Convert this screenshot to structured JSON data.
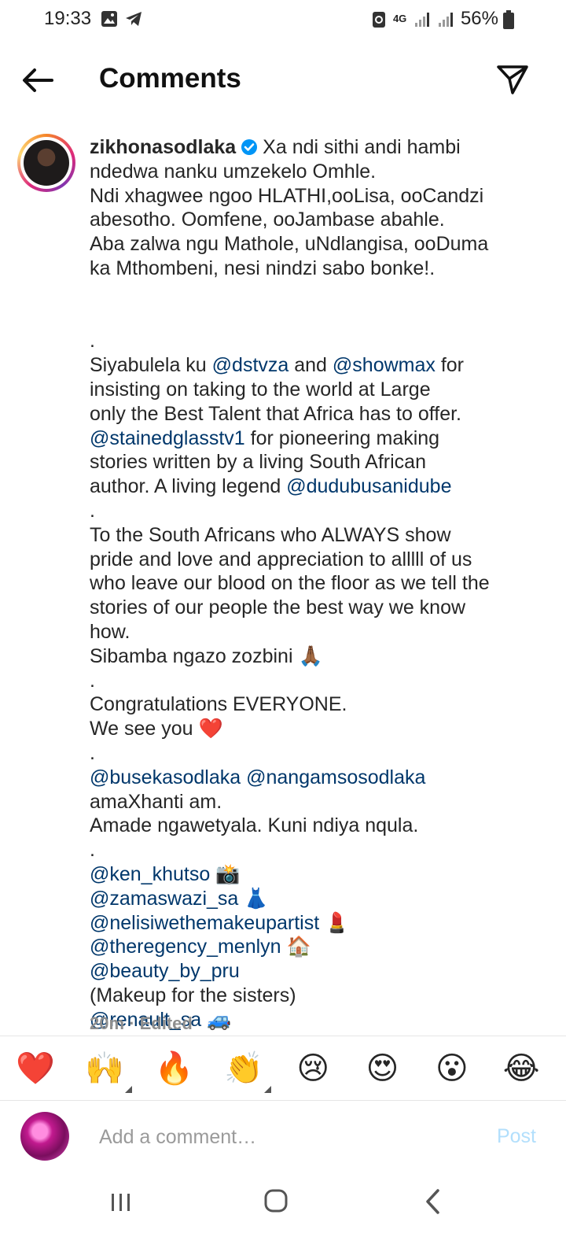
{
  "status_bar": {
    "time": "19:33",
    "network": "4G",
    "battery": "56%",
    "icons": [
      "gallery-icon",
      "telegram-icon",
      "data-saver-icon",
      "signal-icon",
      "signal-icon",
      "battery-icon"
    ]
  },
  "header": {
    "title": "Comments",
    "back_icon": "arrow-left-icon",
    "share_icon": "paper-plane-icon"
  },
  "caption": {
    "username": "zikhonasodlaka",
    "verified": true,
    "lines": [
      [
        {
          "t": "Xa ndi sithi andi hambi"
        }
      ],
      [
        {
          "t": "ndedwa nanku umzekelo Omhle."
        }
      ],
      [
        {
          "t": "Ndi xhagwee ngoo HLATHI,ooLisa, ooCandzi"
        }
      ],
      [
        {
          "t": "abesotho. Oomfene, ooJambase abahle."
        }
      ],
      [
        {
          "t": "Aba zalwa ngu Mathole, uNdlangisa, ooDuma"
        }
      ],
      [
        {
          "t": "ka Mthombeni, nesi nindzi sabo bonke!."
        }
      ],
      [],
      [],
      [
        {
          "t": "."
        }
      ],
      [
        {
          "t": "Siyabulela ku "
        },
        {
          "t": "@dstvza",
          "m": true
        },
        {
          "t": " and "
        },
        {
          "t": "@showmax",
          "m": true
        },
        {
          "t": " for"
        }
      ],
      [
        {
          "t": "insisting on taking to the world at Large"
        }
      ],
      [
        {
          "t": "only the Best Talent that Africa has to offer."
        }
      ],
      [
        {
          "t": "@stainedglasstv1",
          "m": true
        },
        {
          "t": " for pioneering making"
        }
      ],
      [
        {
          "t": "stories written by a living South African"
        }
      ],
      [
        {
          "t": "author. A living legend "
        },
        {
          "t": "@dudubusanidube",
          "m": true
        }
      ],
      [
        {
          "t": "."
        }
      ],
      [
        {
          "t": "To the South Africans who ALWAYS show"
        }
      ],
      [
        {
          "t": "pride and love and appreciation to alllll of us"
        }
      ],
      [
        {
          "t": "who leave our blood on the floor as we tell the"
        }
      ],
      [
        {
          "t": "stories of our people the best way we know"
        }
      ],
      [
        {
          "t": "how."
        }
      ],
      [
        {
          "t": "Sibamba ngazo zozbini 🙏🏾"
        }
      ],
      [
        {
          "t": "."
        }
      ],
      [
        {
          "t": "Congratulations EVERYONE."
        }
      ],
      [
        {
          "t": "We see you ❤️"
        }
      ],
      [
        {
          "t": "."
        }
      ],
      [
        {
          "t": "@busekasodlaka",
          "m": true
        },
        {
          "t": " "
        },
        {
          "t": "@nangamsosodlaka",
          "m": true
        }
      ],
      [
        {
          "t": "amaXhanti am."
        }
      ],
      [
        {
          "t": "Amade ngawetyala. Kuni ndiya nqula."
        }
      ],
      [
        {
          "t": "."
        }
      ],
      [
        {
          "t": "@ken_khutso",
          "m": true
        },
        {
          "t": " 📸"
        }
      ],
      [
        {
          "t": "@zamaswazi_sa",
          "m": true
        },
        {
          "t": " 👗"
        }
      ],
      [
        {
          "t": "@nelisiwethemakeupartist",
          "m": true
        },
        {
          "t": " 💄"
        }
      ],
      [
        {
          "t": "@theregency_menlyn",
          "m": true
        },
        {
          "t": " 🏠"
        }
      ],
      [
        {
          "t": "@beauty_by_pru",
          "m": true
        }
      ],
      [
        {
          "t": "(Makeup for the sisters)"
        }
      ],
      [
        {
          "t": "@renault_sa",
          "m": true
        },
        {
          "t": " 🚙"
        }
      ]
    ],
    "time_ago": "20m",
    "separator": "·",
    "edited_label": "Edited"
  },
  "reactions": [
    "❤️",
    "🙌",
    "🔥",
    "👏",
    "😢",
    "😍",
    "😮",
    "😂"
  ],
  "reactions_with_skin_tone_option": [
    1,
    3
  ],
  "comment_box": {
    "placeholder": "Add a comment…",
    "post_label": "Post"
  },
  "colors": {
    "mention": "#00376b",
    "post_disabled": "#b2dffc",
    "verified": "#0095f6"
  },
  "nav_bar": [
    "recents-icon",
    "home-icon",
    "back-icon"
  ]
}
